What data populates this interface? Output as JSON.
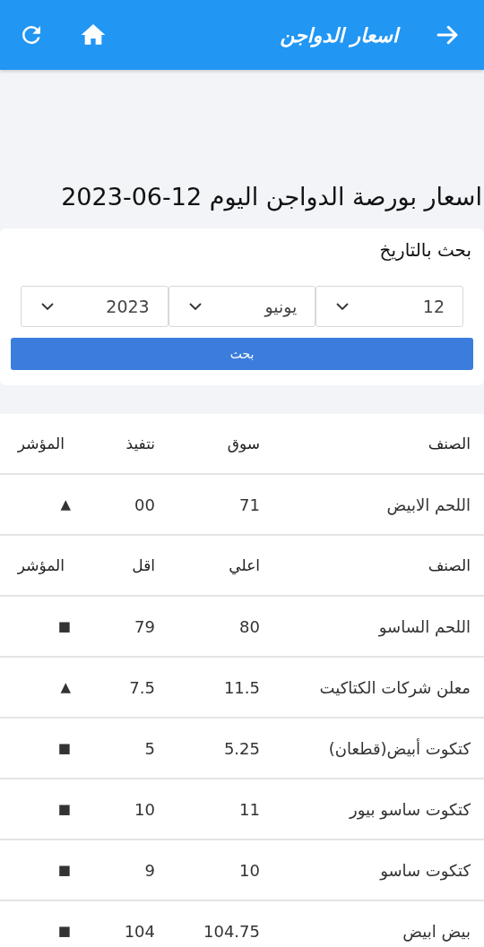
{
  "app_bar": {
    "title": "اسعار الدواجن"
  },
  "page_title": "اسعار بورصة الدواجن اليوم 12-06-2023",
  "search": {
    "label": "بحث بالتاريخ",
    "selects": [
      {
        "value": "12"
      },
      {
        "value": "يونيو"
      },
      {
        "value": "2023"
      }
    ],
    "button": "بحث"
  },
  "table": {
    "sections": [
      {
        "columns": [
          "الصنف",
          "سوق",
          "نتفيذ",
          "المؤشر"
        ],
        "rows": [
          [
            "اللحم الابيض",
            "71",
            "00",
            "▲"
          ]
        ]
      },
      {
        "columns": [
          "الصنف",
          "اعلي",
          "اقل",
          "المؤشر"
        ],
        "rows": [
          [
            "اللحم الساسو",
            "80",
            "79",
            "■"
          ],
          [
            "معلن شركات الكتاكيت",
            "11.5",
            "7.5",
            "▲"
          ],
          [
            "كتكوت أبيض(قطعان)",
            "5.25",
            "5",
            "■"
          ],
          [
            "كتكوت ساسو بيور",
            "11",
            "10",
            "■"
          ],
          [
            "كتكوت ساسو",
            "10",
            "9",
            "■"
          ],
          [
            "بيض ابيض",
            "104.75",
            "104",
            "■"
          ]
        ]
      }
    ]
  }
}
